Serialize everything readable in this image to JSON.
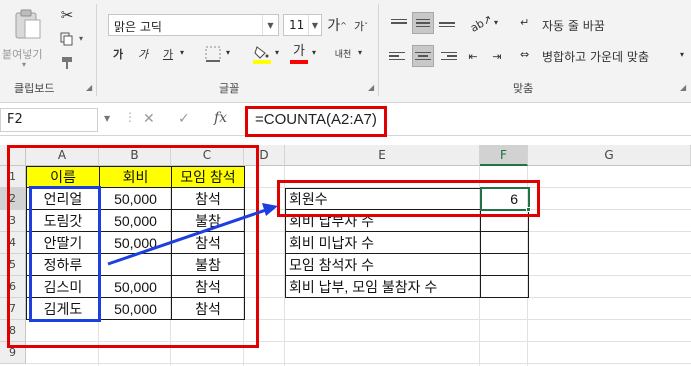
{
  "ribbon": {
    "clipboard": {
      "paste_label": "붙여넣기",
      "group_label": "클립보드"
    },
    "font": {
      "font_name": "맑은 고딕",
      "font_size": "11",
      "bold": "가",
      "italic": "가",
      "underline": "가",
      "grow_font": "가",
      "shrink_font": "가",
      "font_color": "가",
      "phonetic": "내천",
      "group_label": "글꼴",
      "highlight_color": "#ffff00",
      "font_color_value": "#ff0000"
    },
    "alignment": {
      "wrap_text": "자동 줄 바꿈",
      "merge_center": "병합하고 가운데 맞춤",
      "group_label": "맞춤"
    }
  },
  "formula_bar": {
    "name_box": "F2",
    "formula": "=COUNTA(A2:A7)"
  },
  "grid": {
    "columns": [
      "A",
      "B",
      "C",
      "D",
      "E",
      "F",
      "G"
    ],
    "rows": [
      "1",
      "2",
      "3",
      "4",
      "5",
      "6",
      "7",
      "8",
      "9"
    ],
    "table_headers": [
      "이름",
      "회비",
      "모임 참석"
    ],
    "table_rows": [
      {
        "name": "언리얼",
        "fee": "50,000",
        "attend": "참석"
      },
      {
        "name": "도림갓",
        "fee": "50,000",
        "attend": "불참"
      },
      {
        "name": "안딸기",
        "fee": "50,000",
        "attend": "참석"
      },
      {
        "name": "정하루",
        "fee": "",
        "attend": "불참"
      },
      {
        "name": "김스미",
        "fee": "50,000",
        "attend": "참석"
      },
      {
        "name": "김게도",
        "fee": "50,000",
        "attend": "참석"
      }
    ],
    "summary_labels": [
      "회원수",
      "회비 납부자 수",
      "회비 미납자 수",
      "모임 참석자 수",
      "회비 납부, 모임 불참자 수"
    ],
    "summary_values": [
      "6",
      "",
      "",
      "",
      ""
    ]
  },
  "colors": {
    "annotation_red": "#e00000",
    "annotation_blue": "#1d3fe0",
    "header_fill": "#ffff00",
    "excel_green": "#217346"
  }
}
